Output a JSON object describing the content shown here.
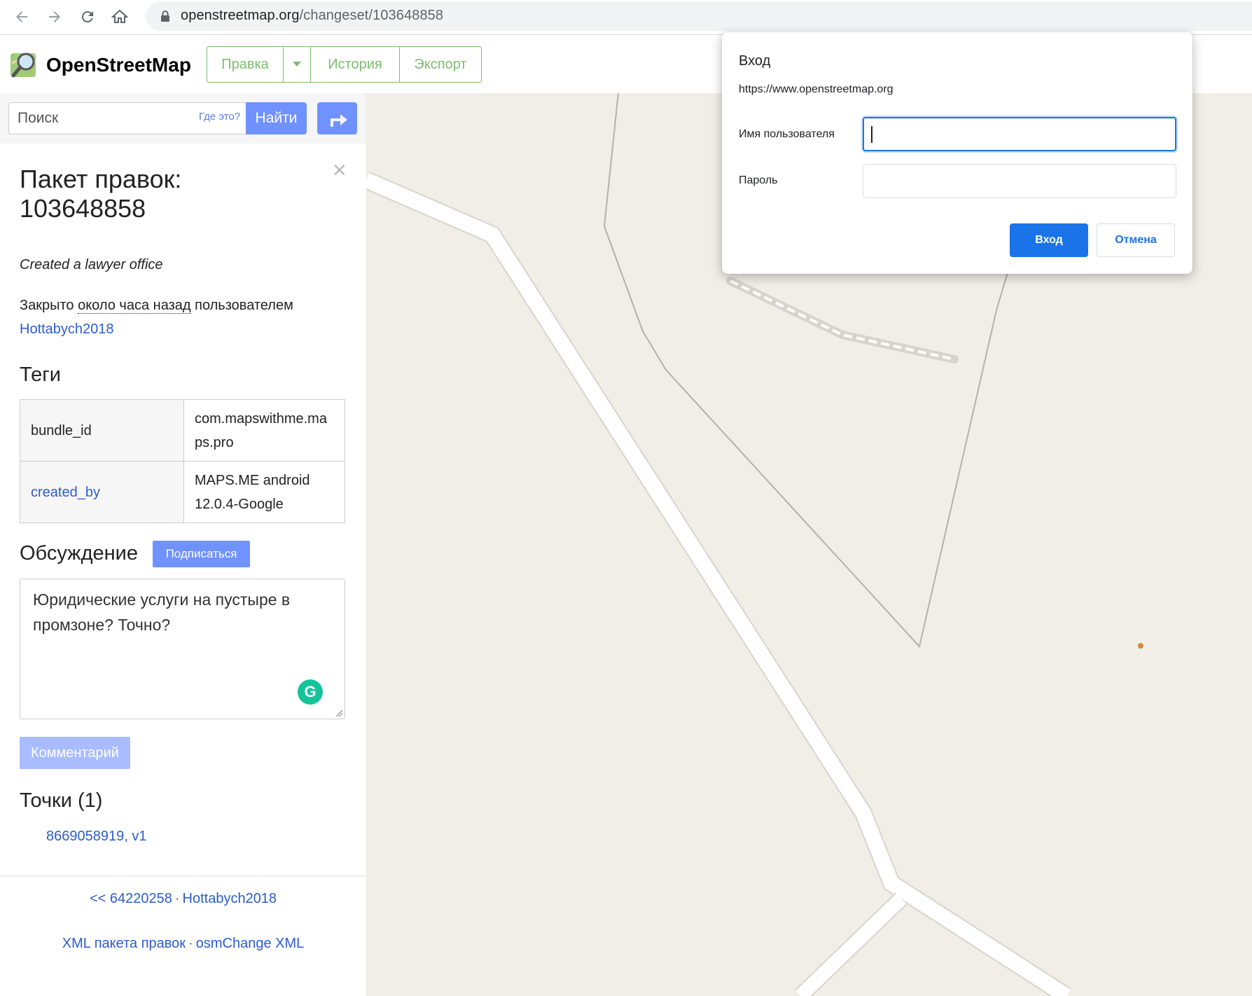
{
  "browser": {
    "url_host": "openstreetmap.org",
    "url_path": "/changeset/103648858"
  },
  "header": {
    "logo_text": "OpenStreetMap",
    "edit_label": "Правка",
    "history_label": "История",
    "export_label": "Экспорт"
  },
  "search": {
    "placeholder": "Поиск",
    "where_link": "Где это?",
    "find_label": "Найти"
  },
  "changeset": {
    "title_line1": "Пакет правок:",
    "title_line2": "103648858",
    "comment": "Created a lawyer office",
    "closed_prefix": "Закрыто ",
    "closed_time": "около часа назад",
    "closed_suffix": " пользователем",
    "user": "Hottabych2018",
    "tags_heading": "Теги",
    "tags": [
      {
        "key": "bundle_id",
        "value_line1": "com.mapswithme.ma",
        "value_line2": "ps.pro"
      },
      {
        "key": "created_by",
        "value_line1": "MAPS.ME android",
        "value_line2": "12.0.4-Google"
      }
    ],
    "discussion_heading": "Обсуждение",
    "subscribe_label": "Подписаться",
    "comment_draft": "Юридические услуги на пустыре в промзоне? Точно?",
    "comment_button": "Комментарий",
    "nodes_heading": "Точки (1)",
    "node_link": "8669058919, v1",
    "prev_link": "<< 64220258",
    "prev_user": "Hottabych2018",
    "xml_link": "XML пакета правок",
    "osmchange_link": "osmChange XML"
  },
  "dialog": {
    "title": "Вход",
    "origin": "https://www.openstreetmap.org",
    "username_label": "Имя пользователя",
    "password_label": "Пароль",
    "username_value": "",
    "password_value": "",
    "ok_label": "Вход",
    "cancel_label": "Отмена"
  },
  "colors": {
    "osm_green": "#7ebc6f",
    "button_blue": "#7092ff",
    "link_blue": "#2c5dcd",
    "chrome_blue": "#1a73e8",
    "map_background": "#f1eee8"
  }
}
